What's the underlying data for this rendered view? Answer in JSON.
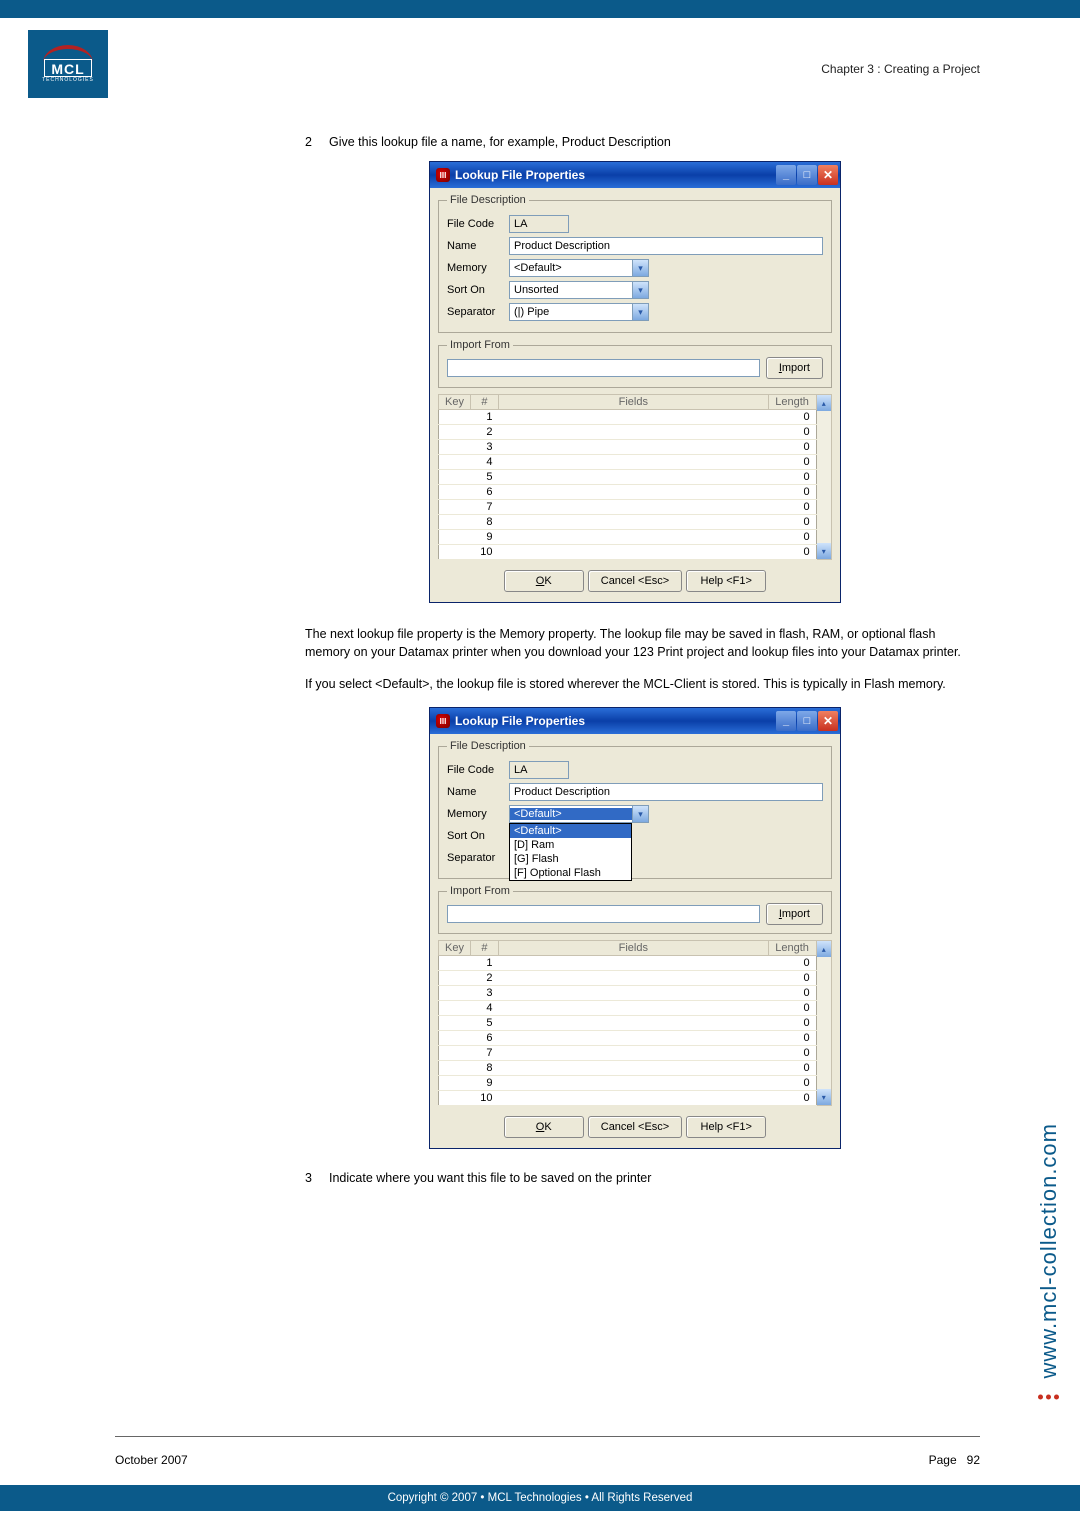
{
  "header": {
    "chapter": "Chapter 3 : Creating a Project"
  },
  "steps": {
    "s2_num": "2",
    "s2_txt": "Give this lookup file a name, for example, Product Description",
    "s3_num": "3",
    "s3_txt": "Indicate where you want this file to be saved on the printer"
  },
  "body": {
    "p1": "The next lookup file property is the Memory property. The lookup file may be saved in flash, RAM, or optional flash memory on your Datamax printer when you download your 123 Print project and lookup files into your Datamax printer.",
    "p2": "If you select <Default>, the lookup file is stored wherever the MCL-Client is stored. This is typically in Flash memory."
  },
  "dialog": {
    "title": "Lookup File Properties",
    "fs_file": "File Description",
    "fs_import": "Import From",
    "lbl_code": "File Code",
    "lbl_name": "Name",
    "lbl_mem": "Memory",
    "lbl_sort": "Sort On",
    "lbl_sep": "Separator",
    "val_code": "LA",
    "val_name": "Product Description",
    "val_mem": "<Default>",
    "val_sort": "Unsorted",
    "val_sep": "(|) Pipe",
    "btn_import": "Import",
    "col_key": "Key",
    "col_num": "#",
    "col_fields": "Fields",
    "col_len": "Length",
    "btn_ok": "OK",
    "btn_cancel": "Cancel <Esc>",
    "btn_help": "Help <F1>",
    "mem_options": {
      "o0": "<Default>",
      "o1": "[D] Ram",
      "o2": "[G] Flash",
      "o3": "[F] Optional Flash"
    },
    "rows": [
      {
        "n": "1",
        "len": "0"
      },
      {
        "n": "2",
        "len": "0"
      },
      {
        "n": "3",
        "len": "0"
      },
      {
        "n": "4",
        "len": "0"
      },
      {
        "n": "5",
        "len": "0"
      },
      {
        "n": "6",
        "len": "0"
      },
      {
        "n": "7",
        "len": "0"
      },
      {
        "n": "8",
        "len": "0"
      },
      {
        "n": "9",
        "len": "0"
      },
      {
        "n": "10",
        "len": "0"
      }
    ]
  },
  "side": {
    "url": "www.mcl-collection.com"
  },
  "footer": {
    "date": "October 2007",
    "page_lbl": "Page",
    "page_num": "92",
    "copyright": "Copyright © 2007 • MCL Technologies • All Rights Reserved"
  }
}
